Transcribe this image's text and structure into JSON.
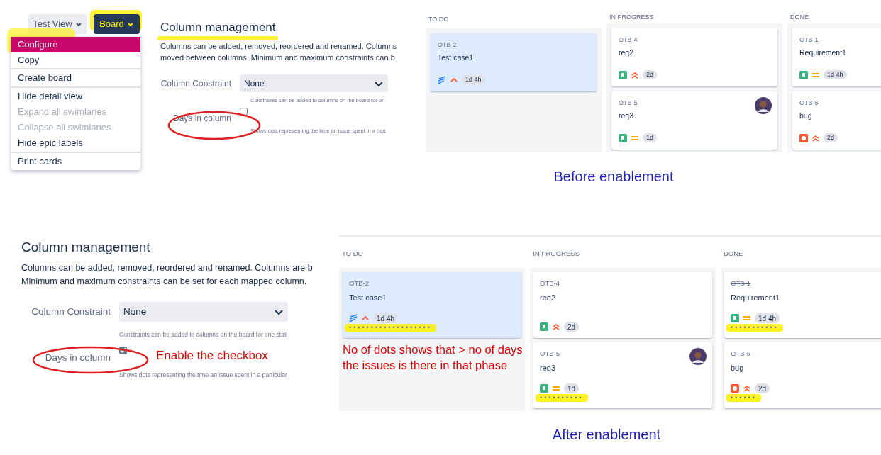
{
  "before": {
    "view_button": "Test View",
    "board_button": "Board",
    "menu_groups": [
      [
        {
          "label": "Configure",
          "selected": true,
          "disabled": false
        },
        {
          "label": "Copy",
          "selected": false,
          "disabled": false
        }
      ],
      [
        {
          "label": "Create board",
          "selected": false,
          "disabled": false
        }
      ],
      [
        {
          "label": "Hide detail view",
          "selected": false,
          "disabled": false
        },
        {
          "label": "Expand all swimlanes",
          "selected": false,
          "disabled": true
        },
        {
          "label": "Collapse all swimlanes",
          "selected": false,
          "disabled": true
        },
        {
          "label": "Hide epic labels",
          "selected": false,
          "disabled": false
        }
      ],
      [
        {
          "label": "Print cards",
          "selected": false,
          "disabled": false
        }
      ]
    ],
    "config": {
      "heading": "Column management",
      "description": [
        "Columns can be added, removed, reordered and renamed. Columns",
        "moved between columns. Minimum and maximum constraints can b"
      ],
      "constraint_label": "Column Constraint",
      "constraint_value": "None",
      "constraint_hint": "Constraints can be added to columns on the board for on",
      "days_label": "Days in column",
      "days_checked": false,
      "days_hint": "Shows dots representing the time an issue spent in a part"
    },
    "board": {
      "columns": [
        {
          "title": "TO DO",
          "cards": [
            {
              "key": "OTB-2",
              "title": "Test case1",
              "icons": [
                {
                  "kind": "subtask"
                },
                {
                  "kind": "priority_high"
                }
              ],
              "time": "1d 4h",
              "done": false,
              "selected": true
            }
          ]
        },
        {
          "title": "IN PROGRESS",
          "cards": [
            {
              "key": "OTB-4",
              "title": "req2",
              "icons": [
                {
                  "kind": "story"
                },
                {
                  "kind": "priority_highest"
                }
              ],
              "time": "2d",
              "done": false,
              "selected": false
            },
            {
              "key": "OTB-5",
              "title": "req3",
              "icons": [
                {
                  "kind": "story"
                },
                {
                  "kind": "priority_medium"
                }
              ],
              "time": "1d",
              "done": false,
              "selected": false,
              "avatar": true
            }
          ]
        },
        {
          "title": "DONE",
          "cards": [
            {
              "key": "OTB-1",
              "title": "Requirement1",
              "icons": [
                {
                  "kind": "story"
                },
                {
                  "kind": "priority_medium"
                }
              ],
              "time": "1d 4h",
              "done": true,
              "selected": false
            },
            {
              "key": "OTB-6",
              "title": "bug",
              "icons": [
                {
                  "kind": "bug"
                },
                {
                  "kind": "priority_highest"
                }
              ],
              "time": "2d",
              "done": true,
              "selected": false
            }
          ]
        }
      ]
    },
    "caption": "Before enablement"
  },
  "after": {
    "config": {
      "heading": "Column management",
      "description": [
        "Columns can be added, removed, reordered and renamed. Columns are b",
        "Minimum and maximum constraints can be set for each mapped column."
      ],
      "constraint_label": "Column Constraint",
      "constraint_value": "None",
      "constraint_hint": "Constraints can be added to columns on the board for one stati",
      "days_label": "Days in column",
      "days_checked": true,
      "days_hint": "Shows dots representing the time an issue spent in a particular"
    },
    "board": {
      "columns": [
        {
          "title": "TO DO",
          "cards": [
            {
              "key": "OTB-2",
              "title": "Test case1",
              "icons": [
                {
                  "kind": "subtask"
                },
                {
                  "kind": "priority_high"
                }
              ],
              "time": "1d 4h",
              "done": false,
              "selected": true,
              "dots": "•••••••••••••••••••"
            }
          ]
        },
        {
          "title": "IN PROGRESS",
          "cards": [
            {
              "key": "OTB-4",
              "title": "req2",
              "icons": [
                {
                  "kind": "story"
                },
                {
                  "kind": "priority_highest"
                }
              ],
              "time": "2d",
              "done": false,
              "selected": false
            },
            {
              "key": "OTB-5",
              "title": "req3",
              "icons": [
                {
                  "kind": "story"
                },
                {
                  "kind": "priority_medium"
                }
              ],
              "time": "1d",
              "done": false,
              "selected": false,
              "avatar": true,
              "dots": "••••••••••"
            }
          ]
        },
        {
          "title": "DONE",
          "cards": [
            {
              "key": "OTB-1",
              "title": "Requirement1",
              "icons": [
                {
                  "kind": "story"
                },
                {
                  "kind": "priority_medium"
                }
              ],
              "time": "1d 4h",
              "done": true,
              "selected": false,
              "dots": "•••••••••••"
            },
            {
              "key": "OTB-6",
              "title": "bug",
              "icons": [
                {
                  "kind": "bug"
                },
                {
                  "kind": "priority_highest"
                }
              ],
              "time": "2d",
              "done": true,
              "selected": false,
              "dots": "••••••"
            }
          ]
        }
      ]
    },
    "caption": "After enablement"
  },
  "annotations": [
    "Enable the checkbox",
    "No of dots shows that > no of days the issues is there in that phase"
  ]
}
